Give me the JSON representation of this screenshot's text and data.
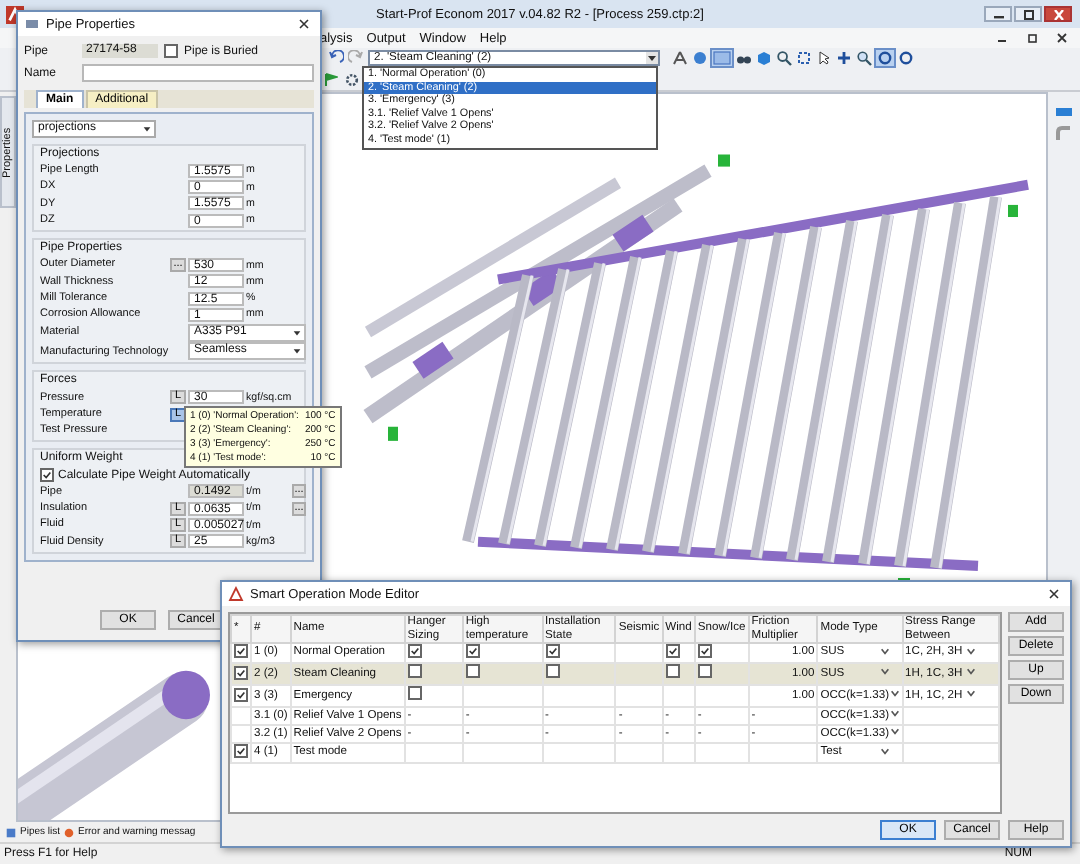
{
  "app": {
    "title": "Start-Prof Econom 2017 v.04.82 R2 - [Process 259.ctp:2]",
    "menu": [
      "alysis",
      "Output",
      "Window",
      "Help"
    ],
    "mode_selector": {
      "value": "2. 'Steam Cleaning' (2)",
      "options": [
        {
          "label": "1. 'Normal Operation' (0)",
          "selected": false
        },
        {
          "label": "2. 'Steam Cleaning' (2)",
          "selected": true
        },
        {
          "label": "3. 'Emergency' (3)",
          "selected": false
        },
        {
          "label": "3.1. 'Relief Valve 1 Opens'",
          "selected": false
        },
        {
          "label": "3.2. 'Relief Valve 2 Opens'",
          "selected": false
        },
        {
          "label": "4. 'Test mode' (1)",
          "selected": false
        }
      ]
    },
    "side_tab": "Properties",
    "bottom_tabs": [
      "Pipes list",
      "Error and warning messag"
    ],
    "status_bar": {
      "hint": "Press F1 for Help",
      "indicator": "NUM"
    }
  },
  "pipe_properties": {
    "title": "Pipe Properties",
    "pipe_label": "Pipe",
    "pipe_value": "27174-58",
    "buried": {
      "label": "Pipe is Buried",
      "checked": false
    },
    "name_label": "Name",
    "tabs": [
      {
        "label": "Main",
        "selected": true
      },
      {
        "label": "Additional",
        "selected": false
      }
    ],
    "view_select": "projections",
    "groups": [
      {
        "title": "Projections",
        "rows": [
          {
            "kind": "input",
            "label": "Pipe Length",
            "value": "1.5575",
            "unit": "m",
            "readonly": false
          },
          {
            "kind": "input",
            "label": "DX",
            "value": "0",
            "unit": "m",
            "readonly": false
          },
          {
            "kind": "input",
            "label": "DY",
            "value": "1.5575",
            "unit": "m",
            "readonly": false
          },
          {
            "kind": "input",
            "label": "DZ",
            "value": "0",
            "unit": "m",
            "readonly": false
          }
        ]
      },
      {
        "title": "Pipe Properties",
        "rows": [
          {
            "kind": "input",
            "label": "Outer Diameter",
            "pre": "...",
            "value": "530",
            "unit": "mm",
            "readonly": false
          },
          {
            "kind": "input",
            "label": "Wall Thickness",
            "value": "12",
            "unit": "mm",
            "readonly": false
          },
          {
            "kind": "input",
            "label": "Mill Tolerance",
            "value": "12.5",
            "unit": "%",
            "readonly": false
          },
          {
            "kind": "input",
            "label": "Corrosion Allowance",
            "value": "1",
            "unit": "mm",
            "readonly": false
          },
          {
            "kind": "select",
            "label": "Material",
            "value": "A335 P91"
          },
          {
            "kind": "select",
            "label": "Manufacturing Technology",
            "value": "Seamless"
          }
        ]
      },
      {
        "title": "Forces",
        "rows": [
          {
            "kind": "input",
            "label": "Pressure",
            "pre": "L",
            "pressed": false,
            "value": "30",
            "unit": "kgf/sq.cm",
            "readonly": false
          },
          {
            "kind": "input",
            "label": "Temperature",
            "pre": "L",
            "pressed": true
          },
          {
            "kind": "input",
            "label": "Test Pressure"
          }
        ]
      },
      {
        "title": "Uniform Weight",
        "rows": [
          {
            "kind": "check",
            "label": "Calculate Pipe Weight Automatically",
            "checked": true
          },
          {
            "kind": "input",
            "label": "Pipe",
            "value": "0.1492",
            "unit": "t/m",
            "post": "...",
            "readonly": true
          },
          {
            "kind": "input",
            "label": "Insulation",
            "pre": "L",
            "pressed": false,
            "value": "0.0635",
            "unit": "t/m",
            "post": "...",
            "readonly": false
          },
          {
            "kind": "input",
            "label": "Fluid",
            "pre": "L",
            "pressed": false,
            "value": "0.005027",
            "unit": "t/m",
            "readonly": false
          },
          {
            "kind": "input",
            "label": "Fluid Density",
            "pre": "L",
            "pressed": false,
            "value": "25",
            "unit": "kg/m3",
            "readonly": false
          }
        ]
      }
    ],
    "tooltip": [
      {
        "mode": "1 (0) 'Normal Operation':",
        "value": "100 °C"
      },
      {
        "mode": "2 (2) 'Steam Cleaning':",
        "value": "200 °C"
      },
      {
        "mode": "3 (3) 'Emergency':",
        "value": "250 °C"
      },
      {
        "mode": "4 (1) 'Test mode':",
        "value": "10 °C"
      }
    ],
    "buttons": [
      "OK",
      "Cancel"
    ]
  },
  "mode_editor": {
    "title": "Smart Operation Mode Editor",
    "columns": [
      "*",
      "#",
      "Name",
      "Hanger Sizing",
      "High temperature",
      "Installation State",
      "Seismic",
      "Wind",
      "Snow/Ice",
      "Friction Multiplier",
      "Mode Type",
      "Stress Range Between"
    ],
    "rows": [
      {
        "selected": false,
        "cells": [
          {
            "kind": "check",
            "checked": true
          },
          {
            "kind": "text",
            "text": "1 (0)"
          },
          {
            "kind": "text",
            "text": "Normal Operation"
          },
          {
            "kind": "check",
            "checked": true
          },
          {
            "kind": "check",
            "checked": true
          },
          {
            "kind": "check",
            "checked": true
          },
          {
            "kind": "blank"
          },
          {
            "kind": "check",
            "checked": true
          },
          {
            "kind": "check",
            "checked": true
          },
          {
            "kind": "number",
            "text": "1.00"
          },
          {
            "kind": "combo",
            "text": "SUS"
          },
          {
            "kind": "combo",
            "text": "1C, 2H, 3H"
          }
        ]
      },
      {
        "selected": true,
        "cells": [
          {
            "kind": "check",
            "checked": true
          },
          {
            "kind": "text",
            "text": "2 (2)"
          },
          {
            "kind": "text",
            "text": "Steam Cleaning"
          },
          {
            "kind": "check",
            "checked": false
          },
          {
            "kind": "check",
            "checked": false
          },
          {
            "kind": "check",
            "checked": false
          },
          {
            "kind": "blank"
          },
          {
            "kind": "check",
            "checked": false
          },
          {
            "kind": "check",
            "checked": false
          },
          {
            "kind": "number",
            "text": "1.00"
          },
          {
            "kind": "combo",
            "text": "SUS"
          },
          {
            "kind": "combo",
            "text": "1H, 1C, 3H"
          }
        ]
      },
      {
        "selected": false,
        "cells": [
          {
            "kind": "check",
            "checked": true
          },
          {
            "kind": "text",
            "text": "3 (3)"
          },
          {
            "kind": "text",
            "text": "Emergency"
          },
          {
            "kind": "check",
            "checked": false
          },
          {
            "kind": "blank"
          },
          {
            "kind": "blank"
          },
          {
            "kind": "blank"
          },
          {
            "kind": "blank"
          },
          {
            "kind": "blank"
          },
          {
            "kind": "number",
            "text": "1.00"
          },
          {
            "kind": "combo",
            "text": "OCC(k=1.33)"
          },
          {
            "kind": "combo",
            "text": "1H, 1C, 2H"
          }
        ]
      },
      {
        "selected": false,
        "cells": [
          {
            "kind": "blank"
          },
          {
            "kind": "text",
            "text": "3.1 (0)"
          },
          {
            "kind": "text",
            "text": "Relief Valve 1 Opens"
          },
          {
            "kind": "text",
            "text": "-"
          },
          {
            "kind": "text",
            "text": "-"
          },
          {
            "kind": "text",
            "text": "-"
          },
          {
            "kind": "text",
            "text": "-"
          },
          {
            "kind": "text",
            "text": "-"
          },
          {
            "kind": "text",
            "text": "-"
          },
          {
            "kind": "text",
            "text": "-"
          },
          {
            "kind": "combo",
            "text": "OCC(k=1.33)"
          },
          {
            "kind": "blank"
          }
        ]
      },
      {
        "selected": false,
        "cells": [
          {
            "kind": "blank"
          },
          {
            "kind": "text",
            "text": "3.2 (1)"
          },
          {
            "kind": "text",
            "text": "Relief Valve 2 Opens"
          },
          {
            "kind": "text",
            "text": "-"
          },
          {
            "kind": "text",
            "text": "-"
          },
          {
            "kind": "text",
            "text": "-"
          },
          {
            "kind": "text",
            "text": "-"
          },
          {
            "kind": "text",
            "text": "-"
          },
          {
            "kind": "text",
            "text": "-"
          },
          {
            "kind": "text",
            "text": "-"
          },
          {
            "kind": "combo",
            "text": "OCC(k=1.33)"
          },
          {
            "kind": "blank"
          }
        ]
      },
      {
        "selected": false,
        "cells": [
          {
            "kind": "check",
            "checked": true
          },
          {
            "kind": "text",
            "text": "4 (1)"
          },
          {
            "kind": "text",
            "text": "Test mode"
          },
          {
            "kind": "blank"
          },
          {
            "kind": "blank"
          },
          {
            "kind": "blank"
          },
          {
            "kind": "blank"
          },
          {
            "kind": "blank"
          },
          {
            "kind": "blank"
          },
          {
            "kind": "blank"
          },
          {
            "kind": "combo",
            "text": "Test"
          },
          {
            "kind": "blank"
          }
        ]
      }
    ],
    "side_buttons": [
      "Add",
      "Delete",
      "Up",
      "Down"
    ],
    "buttons": [
      {
        "label": "OK",
        "default": true
      },
      {
        "label": "Cancel",
        "default": false
      },
      {
        "label": "Help",
        "default": false
      }
    ]
  }
}
